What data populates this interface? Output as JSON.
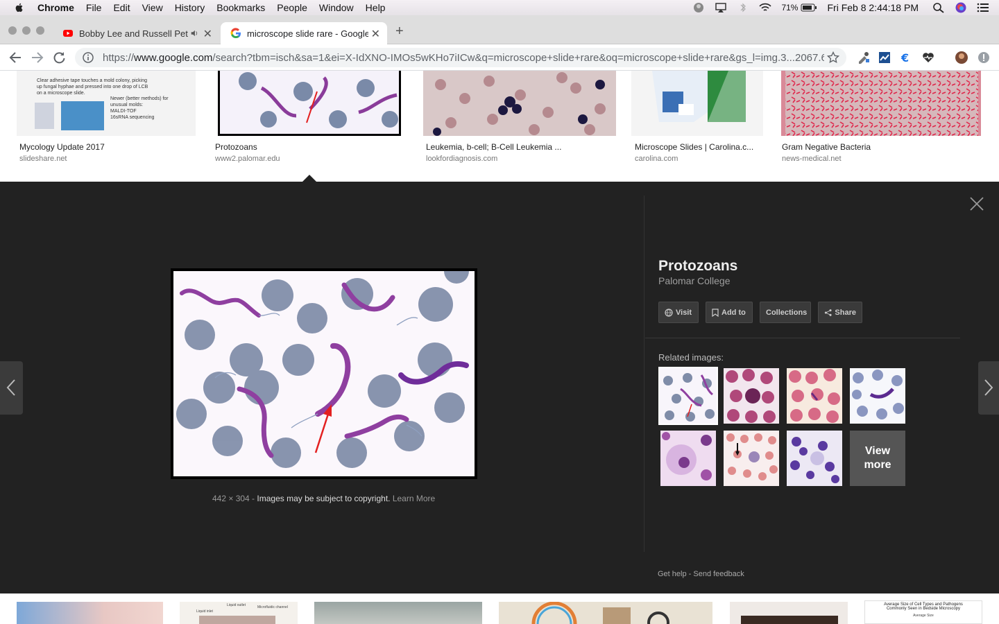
{
  "menubar": {
    "app": "Chrome",
    "items": [
      "File",
      "Edit",
      "View",
      "History",
      "Bookmarks",
      "People",
      "Window",
      "Help"
    ],
    "battery": "71%",
    "datetime": "Fri Feb 8  2:44:18 PM"
  },
  "tabs": [
    {
      "label": "Bobby Lee and Russell Pet",
      "icon": "youtube-icon"
    },
    {
      "label": "microscope slide rare - Google",
      "icon": "google-icon"
    }
  ],
  "toolbar": {
    "url_prefix": "https://",
    "url_host": "www.google.com",
    "url_rest": "/search?tbm=isch&sa=1&ei=X-IdXNO-IMOs5wKHo7iICw&q=microscope+slide+rare&oq=microscope+slide+rare&gs_l=img.3...2067.6..."
  },
  "results": [
    {
      "title": "Mycology Update 2017",
      "source": "slideshare.net",
      "img_text": [
        "Clear adhesive tape touches a mold colony, picking",
        "up fungal hyphae and pressed into one drop of LCB",
        "on a microscope slide.",
        "Newer (better methods) for",
        "unusual molds:",
        "MALDI-TOF",
        "16sRNA sequencing"
      ]
    },
    {
      "title": "Protozoans",
      "source": "www2.palomar.edu"
    },
    {
      "title": "Leukemia, b-cell; B-Cell Leukemia ...",
      "source": "lookfordiagnosis.com"
    },
    {
      "title": "Microscope Slides | Carolina.c...",
      "source": "carolina.com"
    },
    {
      "title": "Gram Negative Bacteria",
      "source": "news-medical.net"
    }
  ],
  "viewer": {
    "title": "Protozoans",
    "subtitle": "Palomar College",
    "buttons": [
      "Visit",
      "Add to",
      "Collections",
      "Share"
    ],
    "related_label": "Related images:",
    "view_more": "View more",
    "dimensions": "442 × 304",
    "separator": " - ",
    "copyright": "Images may be subject to copyright.",
    "learn_more": "Learn More",
    "get_help": "Get help",
    "send_feedback": "Send feedback",
    "footer_sep": " - "
  },
  "bottom_strip": {
    "texts": [
      "Liquid outlet",
      "Microfluidic channel",
      "Liquid inlet",
      "Average Size of Cell Types and Pathogens",
      "Commonly Seen in Bedside Microscopy",
      "Average Size"
    ]
  },
  "colors": {
    "panel_bg": "#222222",
    "accent_red": "#e32020"
  }
}
